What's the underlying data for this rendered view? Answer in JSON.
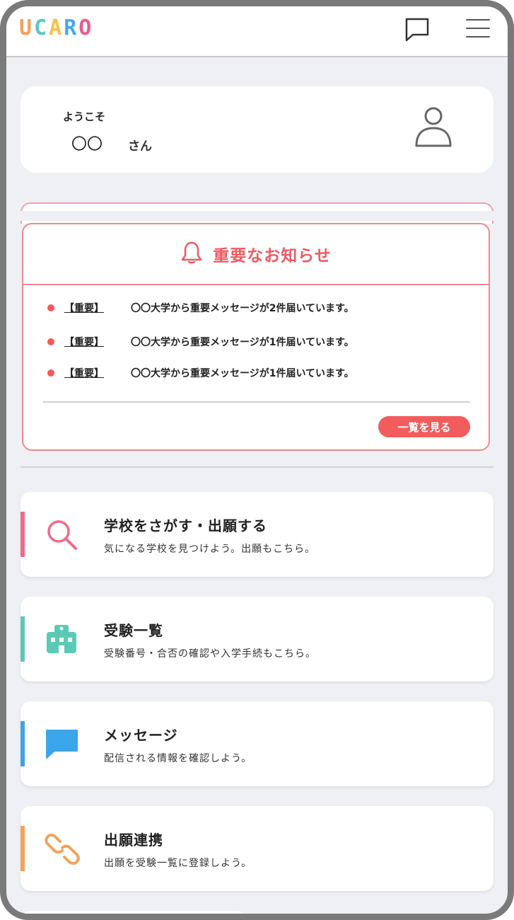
{
  "header": {
    "logo_letters": [
      "U",
      "C",
      "A",
      "R",
      "O"
    ],
    "logo_colors": [
      "#f5a05a",
      "#5bc8c0",
      "#f6c24a",
      "#4aa8e8",
      "#ea5c8a"
    ],
    "chat_icon": "chat-bubble-icon",
    "menu_icon": "hamburger-menu-icon"
  },
  "welcome": {
    "greeting": "ようこそ",
    "name": "〇〇",
    "honorific": "さん",
    "avatar_icon": "user-icon"
  },
  "notice": {
    "title": "重要なお知らせ",
    "icon": "bell-icon",
    "accent": "#ef5a62",
    "items": [
      {
        "tag": "【重要】",
        "message": "〇〇大学から重要メッセージが2件届いています。"
      },
      {
        "tag": "【重要】",
        "message": "〇〇大学から重要メッセージが1件届いています。"
      },
      {
        "tag": "【重要】",
        "message": "〇〇大学から重要メッセージが1件届いています。"
      }
    ],
    "view_all_label": "一覧を見る"
  },
  "menu": [
    {
      "title": "学校をさがす・出願する",
      "description": "気になる学校を見つけよう。出願もこちら。",
      "icon": "search-icon",
      "color": "#ee6b8a"
    },
    {
      "title": "受験一覧",
      "description": "受験番号・合否の確認や入学手続もこちら。",
      "icon": "school-building-icon",
      "color": "#5cc9b6"
    },
    {
      "title": "メッセージ",
      "description": "配信される情報を確認しよう。",
      "icon": "message-bubble-icon",
      "color": "#3ca4ea"
    },
    {
      "title": "出願連携",
      "description": "出願を受験一覧に登録しよう。",
      "icon": "link-icon",
      "color": "#f5a25a"
    }
  ]
}
